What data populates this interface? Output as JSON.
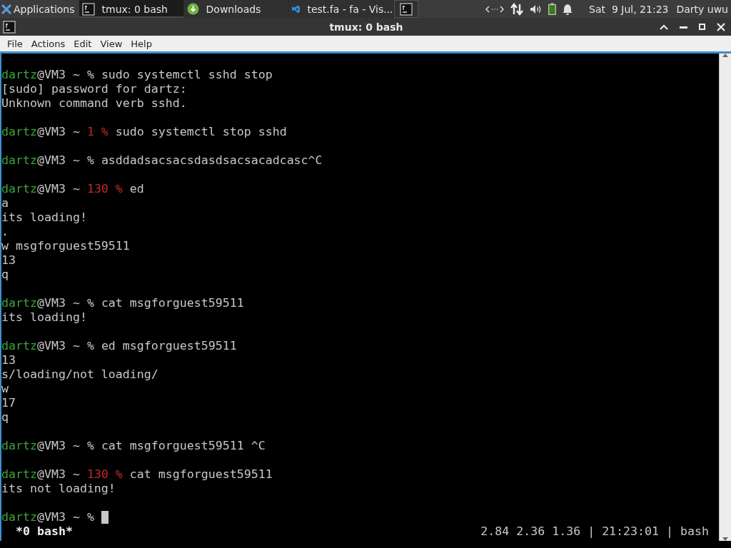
{
  "taskbar": {
    "apps_label": "Applications",
    "tasks": [
      {
        "label": "tmux: 0 bash",
        "kind": "terminal",
        "selected": true
      },
      {
        "label": "Downloads",
        "kind": "download",
        "selected": false
      },
      {
        "label": "test.fa - fa - Vis...",
        "kind": "editor",
        "selected": false
      },
      {
        "kind": "terminal-launcher",
        "selected": false
      }
    ],
    "clock": "Sat  9 Jul, 21:23",
    "user": "Darty uwu"
  },
  "window": {
    "title": "tmux: 0 bash"
  },
  "menu": [
    "File",
    "Actions",
    "Edit",
    "View",
    "Help"
  ],
  "terminal": {
    "lines": [
      {
        "kind": "blank"
      },
      {
        "kind": "prompt",
        "user": "dartz",
        "host": "@VM3 ~",
        "sign": "%",
        "command": "sudo systemctl sshd stop"
      },
      {
        "kind": "output",
        "text": "[sudo] password for dartz:"
      },
      {
        "kind": "output",
        "text": "Unknown command verb sshd."
      },
      {
        "kind": "blank"
      },
      {
        "kind": "prompt",
        "user": "dartz",
        "host": "@VM3 ~",
        "status": "1",
        "sign": "%",
        "command": "sudo systemctl stop sshd"
      },
      {
        "kind": "blank"
      },
      {
        "kind": "prompt",
        "user": "dartz",
        "host": "@VM3 ~",
        "sign": "%",
        "command": "asddadsacsacsdasdsacsacadcasc^C"
      },
      {
        "kind": "blank"
      },
      {
        "kind": "prompt",
        "user": "dartz",
        "host": "@VM3 ~",
        "status": "130",
        "sign": "%",
        "command": "ed"
      },
      {
        "kind": "output",
        "text": "a"
      },
      {
        "kind": "output",
        "text": "its loading!"
      },
      {
        "kind": "output",
        "text": "."
      },
      {
        "kind": "output",
        "text": "w msgforguest59511"
      },
      {
        "kind": "output",
        "text": "13"
      },
      {
        "kind": "output",
        "text": "q"
      },
      {
        "kind": "blank"
      },
      {
        "kind": "prompt",
        "user": "dartz",
        "host": "@VM3 ~",
        "sign": "%",
        "command": "cat msgforguest59511"
      },
      {
        "kind": "output",
        "text": "its loading!"
      },
      {
        "kind": "blank"
      },
      {
        "kind": "prompt",
        "user": "dartz",
        "host": "@VM3 ~",
        "sign": "%",
        "command": "ed msgforguest59511"
      },
      {
        "kind": "output",
        "text": "13"
      },
      {
        "kind": "output",
        "text": "s/loading/not loading/"
      },
      {
        "kind": "output",
        "text": "w"
      },
      {
        "kind": "output",
        "text": "17"
      },
      {
        "kind": "output",
        "text": "q"
      },
      {
        "kind": "blank"
      },
      {
        "kind": "prompt",
        "user": "dartz",
        "host": "@VM3 ~",
        "sign": "%",
        "command": "cat msgforguest59511 ^C"
      },
      {
        "kind": "blank"
      },
      {
        "kind": "prompt",
        "user": "dartz",
        "host": "@VM3 ~",
        "status": "130",
        "sign": "%",
        "command": "cat msgforguest59511"
      },
      {
        "kind": "output",
        "text": "its not loading!"
      },
      {
        "kind": "blank"
      },
      {
        "kind": "prompt",
        "user": "dartz",
        "host": "@VM3 ~",
        "sign": "%",
        "cursor": true
      }
    ]
  },
  "tmux_status": {
    "window": "*0 bash*",
    "right": "2.84 2.36 1.36 | 21:23:01 | bash"
  }
}
